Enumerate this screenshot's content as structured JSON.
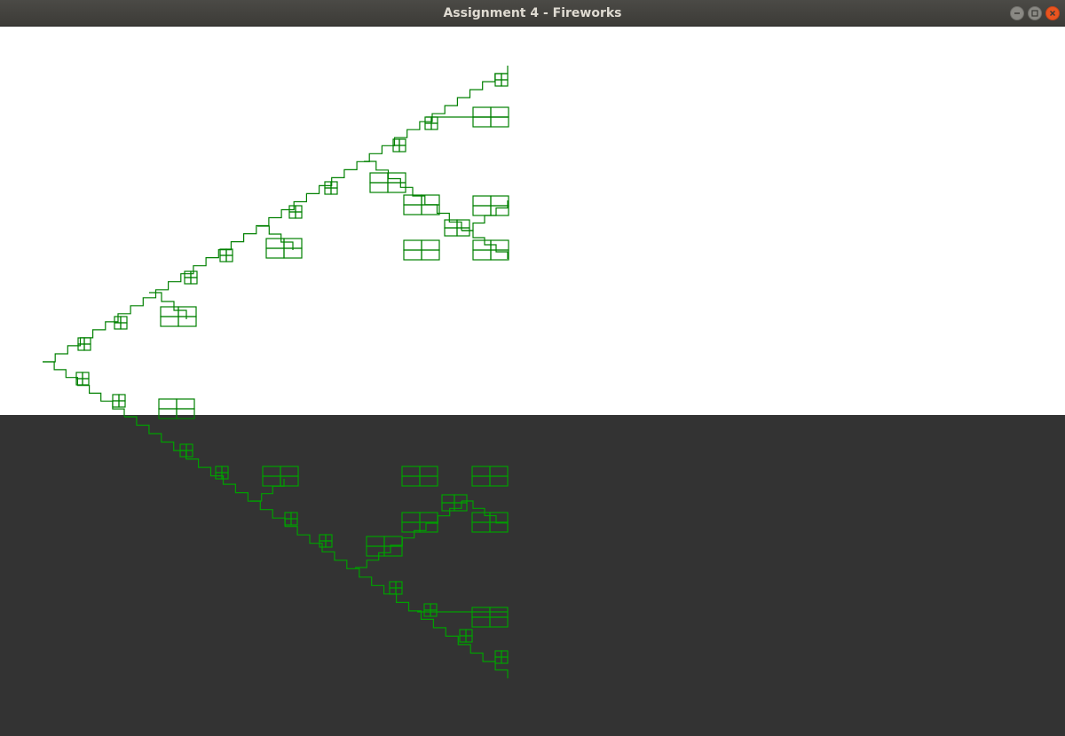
{
  "window": {
    "title": "Assignment 4 - Fireworks",
    "controls": [
      "minimize-icon",
      "maximize-icon",
      "close-icon"
    ]
  },
  "scene": {
    "sky_color": "#ffffff",
    "ground_color": "#333333",
    "upper_curve_color": "#008000",
    "reflection_color": "#00a000"
  }
}
